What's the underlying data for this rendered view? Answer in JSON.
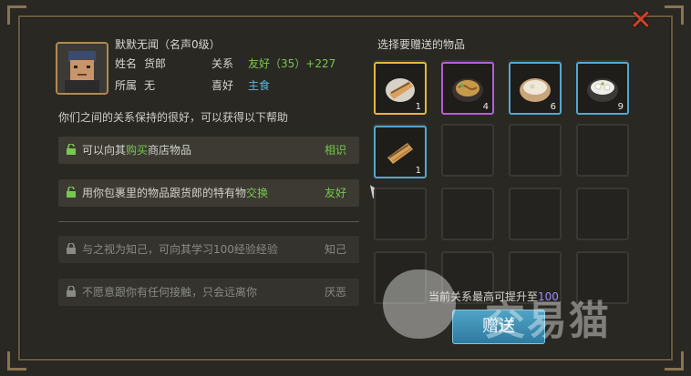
{
  "header": {
    "name": "默默无闻（名声0级）",
    "name_label": "姓名",
    "name_value": "货郎",
    "relation_label": "关系",
    "relation_value": "友好（35）+227",
    "belong_label": "所属",
    "belong_value": "无",
    "like_label": "喜好",
    "like_value": "主食"
  },
  "hint": "你们之间的关系保持的很好，可以获得以下帮助",
  "help_rows": [
    {
      "pre": "可以向其",
      "hi": "购买",
      "post": "商店物品",
      "tag": "相识"
    },
    {
      "pre": "用你包裹里的物品跟货郎的特有物",
      "hi": "交换",
      "post": "",
      "tag": "友好"
    },
    {
      "pre": "与之视为知己，可向其学习100经验经验",
      "hi": "",
      "post": "",
      "tag": "知己"
    },
    {
      "pre": "不愿意跟你有任何接触，只会远离你",
      "hi": "",
      "post": "",
      "tag": "厌恶"
    }
  ],
  "gift_panel": {
    "title": "选择要赠送的物品",
    "items": [
      {
        "name": "roll-food-icon",
        "count": "1",
        "rarity": "gold"
      },
      {
        "name": "noodle-bowl-icon",
        "count": "4",
        "rarity": "purple"
      },
      {
        "name": "rice-bowl-icon",
        "count": "6",
        "rarity": "blue"
      },
      {
        "name": "soup-bowl-icon",
        "count": "9",
        "rarity": "blue"
      },
      {
        "name": "roll-food-icon",
        "count": "1",
        "rarity": "blue"
      }
    ],
    "upgrade_text_prefix": "当前关系最高可提升至",
    "upgrade_value": "100",
    "give_button": "赠送"
  },
  "watermark": "交易猫",
  "colors": {
    "accent_green": "#77c84f",
    "accent_blue": "#5cb5df",
    "gold_border": "#e7b640",
    "purple_border": "#b35fd6",
    "blue_border": "#54a7cf"
  }
}
